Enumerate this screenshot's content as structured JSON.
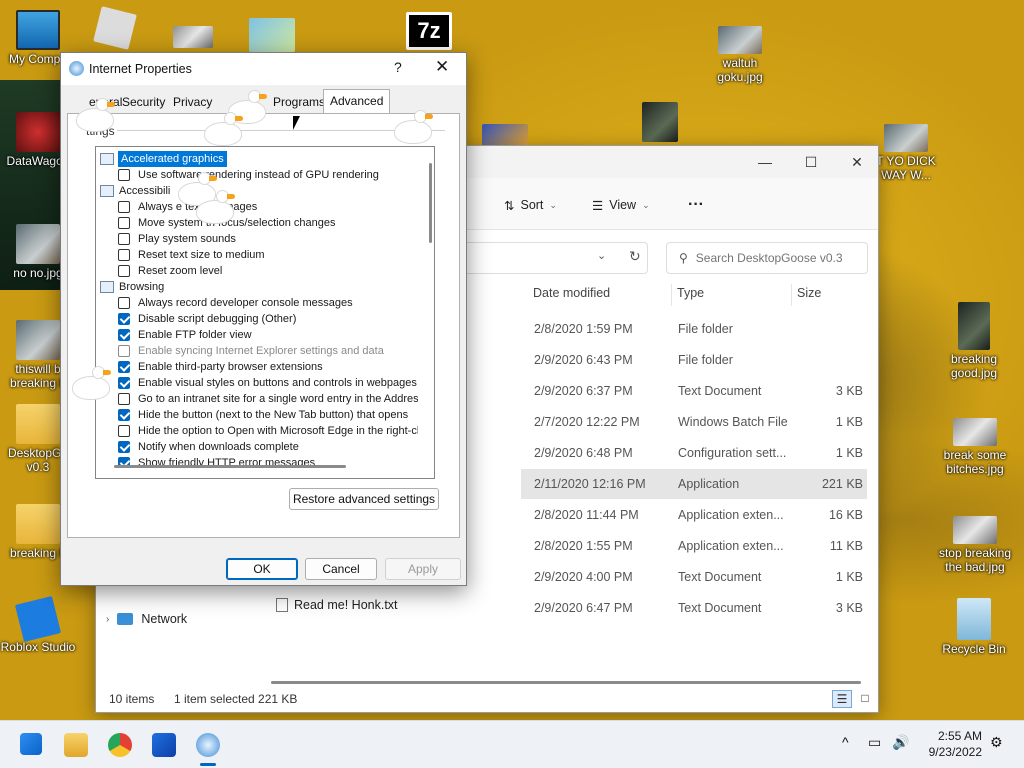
{
  "desktop": {
    "icons": [
      {
        "label": "My Compu"
      },
      {
        "label": "DataWagon"
      },
      {
        "label": "no no.jpg"
      },
      {
        "label": "thiswill b breaking b"
      },
      {
        "label": "DesktopGo v0.3"
      },
      {
        "label": "breaking b"
      },
      {
        "label": "Roblox Studio"
      },
      {
        "label": "waltuh goku.jpg"
      },
      {
        "label": "T YO DICK WAY W..."
      },
      {
        "label": "breaking good.jpg"
      },
      {
        "label": "break some bitches.jpg"
      },
      {
        "label": "stop breaking the bad.jpg"
      },
      {
        "label": "Recycle Bin"
      },
      {
        "label": "7z"
      }
    ]
  },
  "explorer": {
    "commands": {
      "sort": "Sort",
      "view": "View",
      "more": "···"
    },
    "search_placeholder": "Search DesktopGoose v0.3",
    "columns": {
      "date": "Date modified",
      "type": "Type",
      "size": "Size"
    },
    "rows": [
      {
        "date": "2/8/2020 1:59 PM",
        "type": "File folder",
        "size": ""
      },
      {
        "date": "2/9/2020 6:43 PM",
        "type": "File folder",
        "size": ""
      },
      {
        "date": "2/9/2020 6:37 PM",
        "type": "Text Document",
        "size": "3 KB"
      },
      {
        "date": "2/7/2020 12:22 PM",
        "type": "Windows Batch File",
        "size": "1 KB"
      },
      {
        "date": "2/9/2020 6:48 PM",
        "type": "Configuration sett...",
        "size": "1 KB"
      },
      {
        "date": "2/11/2020 12:16 PM",
        "type": "Application",
        "size": "221 KB"
      },
      {
        "date": "2/8/2020 11:44 PM",
        "type": "Application exten...",
        "size": "16 KB"
      },
      {
        "date": "2/8/2020 1:55 PM",
        "type": "Application exten...",
        "size": "11 KB"
      },
      {
        "date": "2/9/2020 4:00 PM",
        "type": "Text Document",
        "size": "1 KB"
      },
      {
        "date": "2/9/2020 6:47 PM",
        "type": "Text Document",
        "size": "3 KB"
      }
    ],
    "visible_file_name": "Read me! Honk.txt",
    "nav_network": "Network",
    "status": {
      "items": "10 items",
      "selected": "1 item selected  221 KB"
    }
  },
  "dialog": {
    "title": "Internet Properties",
    "help": "?",
    "close": "✕",
    "tabs": [
      "eneral",
      "Security",
      "Privacy",
      "Programs",
      "Advanced"
    ],
    "group_label": "ttings",
    "settings": [
      {
        "kind": "cat",
        "label": "Accelerated graphics",
        "highlight": true
      },
      {
        "kind": "cb",
        "label": "Use software rendering instead of GPU rendering",
        "checked": false
      },
      {
        "kind": "cat",
        "label": "Accessibili"
      },
      {
        "kind": "cb",
        "label": "Always e          text for images",
        "checked": false
      },
      {
        "kind": "cb",
        "label": "Move system          th focus/selection changes",
        "checked": false
      },
      {
        "kind": "cb",
        "label": "Play system sounds",
        "checked": false
      },
      {
        "kind": "cb",
        "label": "Reset text size to medium",
        "checked": false
      },
      {
        "kind": "cb",
        "label": "Reset zoom level",
        "checked": false
      },
      {
        "kind": "cat",
        "label": "Browsing"
      },
      {
        "kind": "cb",
        "label": "Always record developer console messages",
        "checked": false
      },
      {
        "kind": "cb",
        "label": "Disable script debugging (Other)",
        "checked": true
      },
      {
        "kind": "cb",
        "label": "Enable FTP folder view",
        "checked": true
      },
      {
        "kind": "cb",
        "label": "Enable syncing Internet Explorer settings and data",
        "checked": false,
        "disabled": true
      },
      {
        "kind": "cb",
        "label": "Enable third-party browser extensions",
        "checked": true
      },
      {
        "kind": "cb",
        "label": "Enable visual styles on buttons and controls in webpages",
        "checked": true
      },
      {
        "kind": "cb",
        "label": "Go to an intranet site for a single word entry in the Addres",
        "checked": false
      },
      {
        "kind": "cb",
        "label": "Hide the button (next to the New Tab button) that opens",
        "checked": true
      },
      {
        "kind": "cb",
        "label": "Hide the option to Open with Microsoft Edge in the right-cl",
        "checked": false
      },
      {
        "kind": "cb",
        "label": "Notify when downloads complete",
        "checked": true
      },
      {
        "kind": "cb",
        "label": "Show friendly HTTP error messages",
        "checked": true
      }
    ],
    "restore_button": "Restore advanced settings",
    "ok": "OK",
    "cancel": "Cancel",
    "apply": "Apply"
  },
  "taskbar": {
    "time": "2:55 AM",
    "date": "9/23/2022",
    "chevron": "^"
  },
  "colors": {
    "accent": "#0067c0",
    "selection": "#0078d7",
    "wallpaper": "#d9aa17"
  }
}
